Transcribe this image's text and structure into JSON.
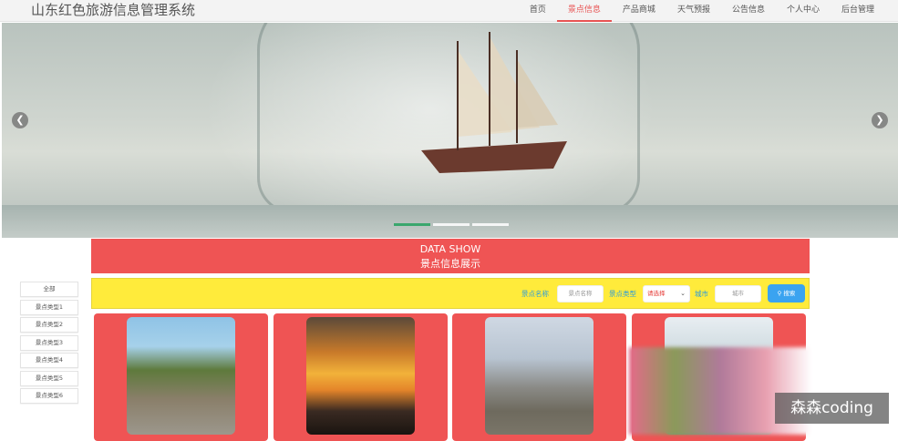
{
  "header": {
    "title": "山东红色旅游信息管理系统",
    "nav": [
      "首页",
      "景点信息",
      "产品商城",
      "天气预报",
      "公告信息",
      "个人中心",
      "后台管理"
    ],
    "active_index": 1
  },
  "banner": {
    "prev_icon": "chevron-left-icon",
    "next_icon": "chevron-right-icon",
    "slides": 3,
    "active_slide": 0
  },
  "data_show": {
    "line1": "DATA SHOW",
    "line2": "景点信息展示"
  },
  "sidebar": {
    "items": [
      "全部",
      "景点类型1",
      "景点类型2",
      "景点类型3",
      "景点类型4",
      "景点类型5",
      "景点类型6"
    ]
  },
  "search": {
    "name_label": "景点名称",
    "name_placeholder": "景点名称",
    "type_label": "景点类型",
    "type_selected": "请选择",
    "city_label": "城市",
    "city_placeholder": "城市",
    "button_label": "搜索",
    "button_icon": "search-icon"
  },
  "cards": [
    {
      "image": "great-wall-photo"
    },
    {
      "image": "sailboat-sunset-photo"
    },
    {
      "image": "monument-city-photo"
    },
    {
      "image": "scenery-photo"
    }
  ],
  "watermark": "森森coding",
  "colors": {
    "accent_red": "#ef5454",
    "search_bar": "#ffeb3b",
    "search_button": "#3aa3f0",
    "label_blue": "#2d9cdb"
  }
}
